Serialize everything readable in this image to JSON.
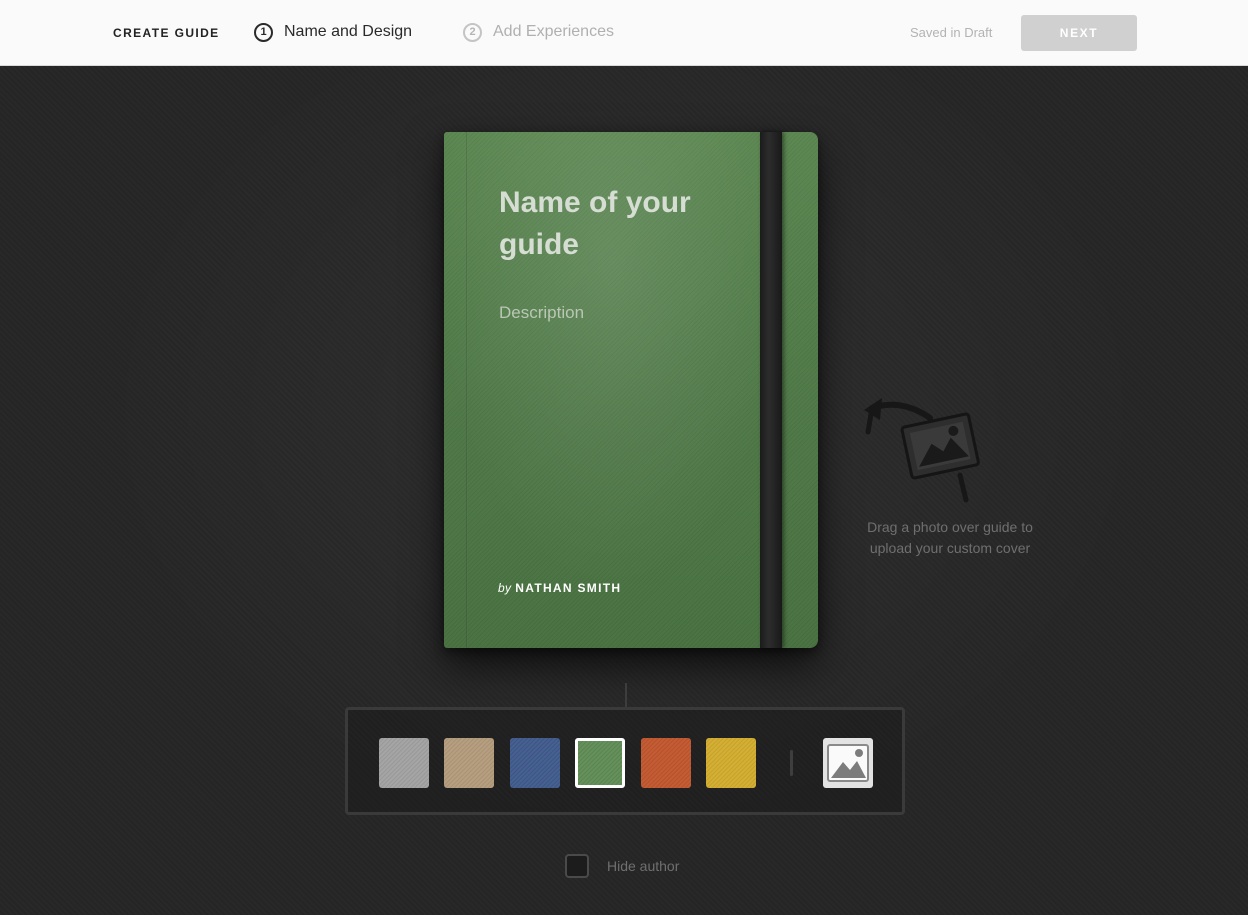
{
  "header": {
    "title": "CREATE GUIDE",
    "steps": [
      {
        "number": "1",
        "label": "Name and Design",
        "state": "active"
      },
      {
        "number": "2",
        "label": "Add Experiences",
        "state": "inactive"
      }
    ],
    "save_status": "Saved in Draft",
    "next_label": "NEXT"
  },
  "book": {
    "title": "Name of your guide",
    "description": "Description",
    "by_label": "by",
    "author": "NATHAN SMITH",
    "cover_color": "#517a48",
    "band_color": "#1e1e1e"
  },
  "drag_hint": {
    "icon": "drag-photo-icon",
    "text": "Drag a photo over guide to upload your custom cover"
  },
  "cover_options": {
    "colors": [
      {
        "name": "gray",
        "hex": "#a1a1a1",
        "selected": false
      },
      {
        "name": "tan",
        "hex": "#b39a7b",
        "selected": false
      },
      {
        "name": "blue",
        "hex": "#3f5a8c",
        "selected": false
      },
      {
        "name": "green",
        "hex": "#5f8c55",
        "selected": true
      },
      {
        "name": "orange",
        "hex": "#c1562d",
        "selected": false
      },
      {
        "name": "yellow",
        "hex": "#d2ac2d",
        "selected": false
      }
    ],
    "custom_photo_icon": "image-icon"
  },
  "hide_author": {
    "label": "Hide author",
    "checked": false
  }
}
